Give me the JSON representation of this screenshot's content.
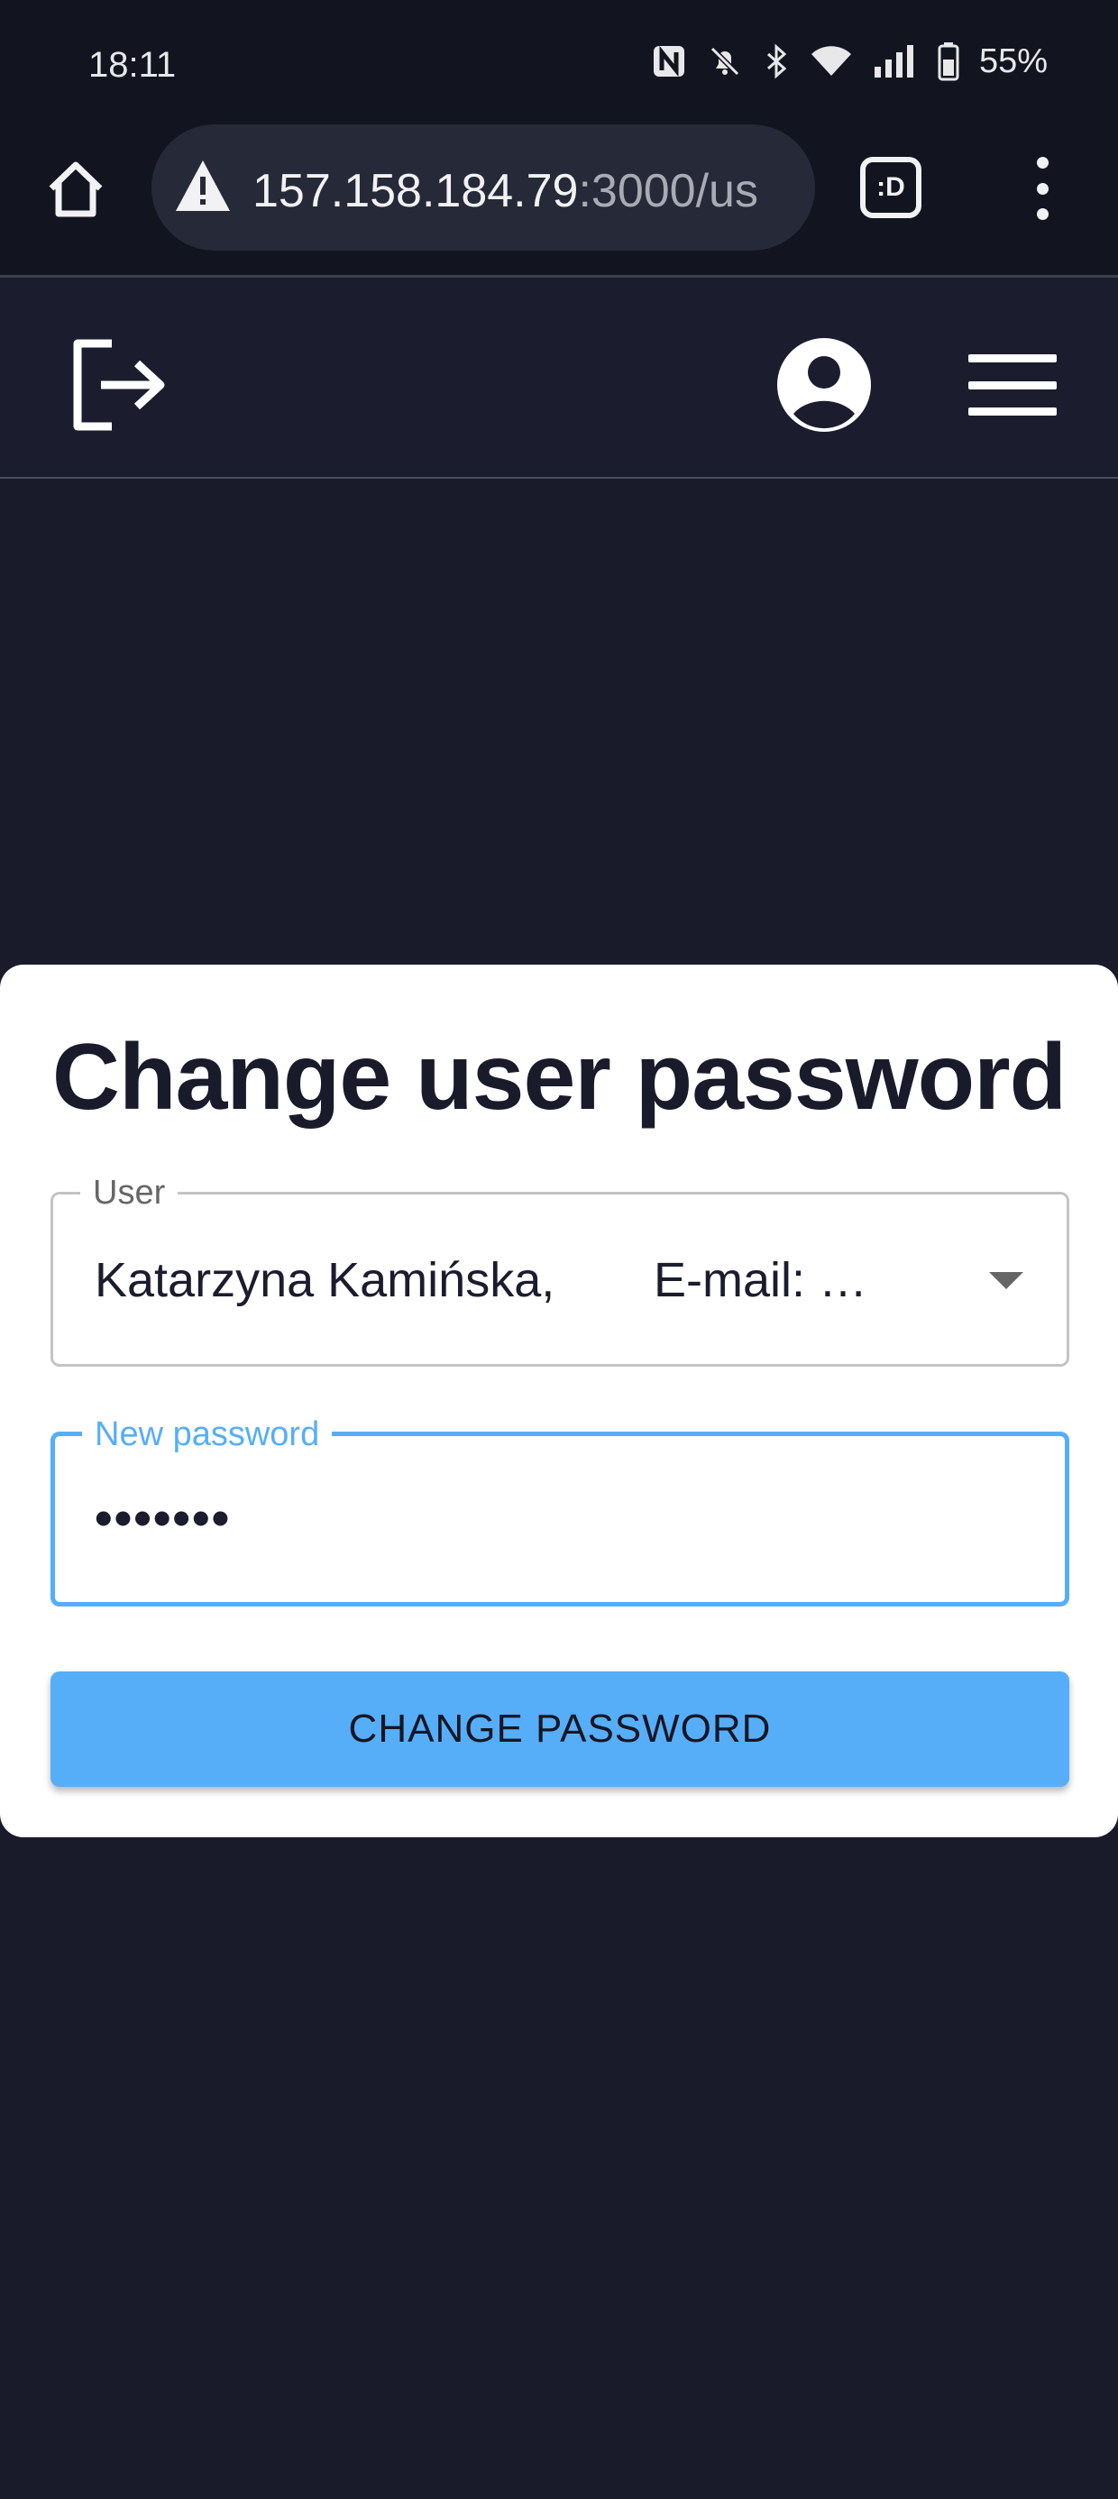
{
  "status_bar": {
    "time": "18:11",
    "battery": "55%",
    "icons": [
      "nfc-icon",
      "bell-muted-icon",
      "bluetooth-icon",
      "wifi-icon",
      "signal-icon",
      "battery-icon"
    ]
  },
  "browser": {
    "url_main": "157.158.184.79",
    "url_rest": ":3000/us",
    "tab_switcher_label": ":D",
    "icons": [
      "home-icon",
      "warning-icon",
      "tab-switcher-icon",
      "more-menu-icon"
    ]
  },
  "header": {
    "icons": [
      "logout-icon",
      "account-icon",
      "hamburger-menu-icon"
    ]
  },
  "form": {
    "title": "Change user password",
    "user_field": {
      "label": "User",
      "value_name": "Katarzyna Kamińska,",
      "value_email": "E-mail: …"
    },
    "password_field": {
      "label": "New password",
      "value": "•••••••"
    },
    "submit_label": "CHANGE PASSWORD"
  },
  "colors": {
    "background": "#191b2b",
    "accent": "#56aef9",
    "card": "#ffffff"
  }
}
